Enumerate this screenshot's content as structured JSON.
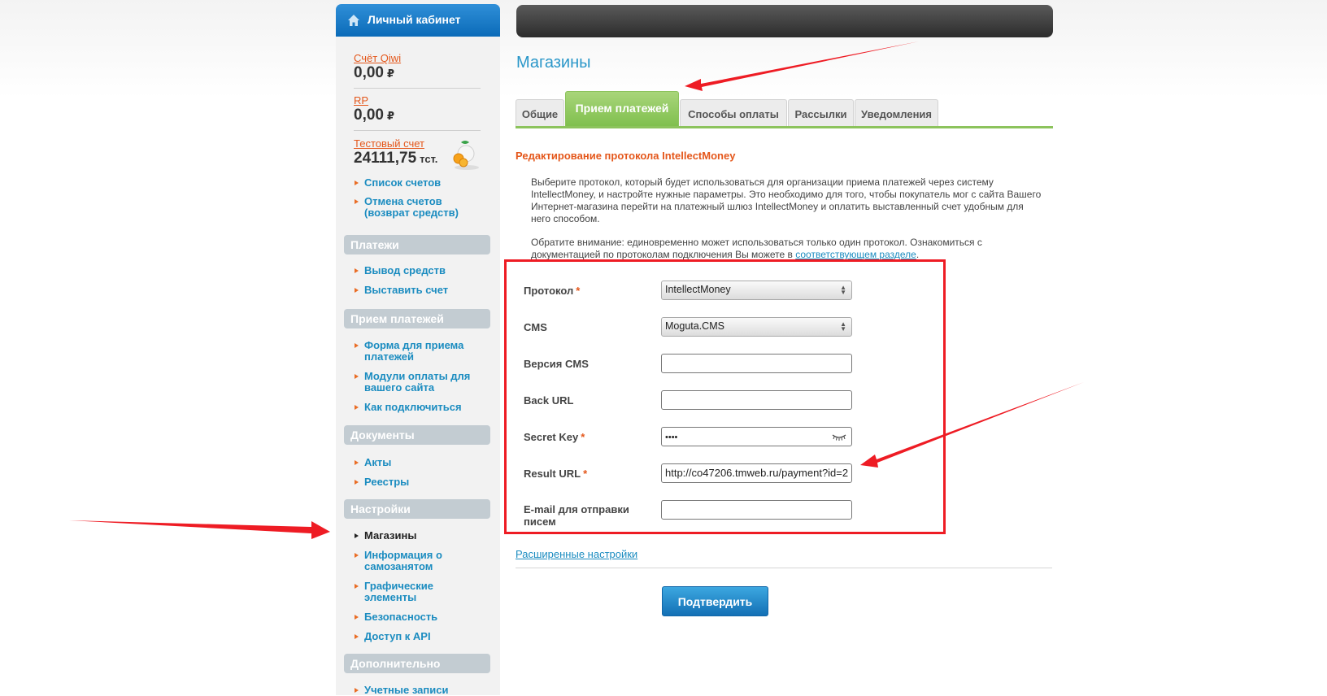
{
  "sidebar": {
    "header": "Личный кабинет",
    "accounts": [
      {
        "label": "Счёт Qiwi",
        "amount": "0,00",
        "currency": "₽"
      },
      {
        "label": "RP",
        "amount": "0,00",
        "currency": "₽"
      },
      {
        "label": "Тестовый счет",
        "amount": "24111,75",
        "currency": "тст."
      }
    ],
    "accounts_menu": [
      "Список счетов",
      "Отмена счетов (возврат средств)"
    ],
    "sections": [
      {
        "title": "Платежи",
        "items": [
          "Вывод средств",
          "Выставить счет"
        ]
      },
      {
        "title": "Прием платежей",
        "items": [
          "Форма для приема платежей",
          "Модули оплаты для вашего сайта",
          "Как подключиться"
        ]
      },
      {
        "title": "Документы",
        "items": [
          "Акты",
          "Реестры"
        ]
      },
      {
        "title": "Настройки",
        "items": [
          "Магазины",
          "Информация о самозанятом",
          "Графические элементы",
          "Безопасность",
          "Доступ к API"
        ]
      },
      {
        "title": "Дополнительно",
        "items": [
          "Учетные записи"
        ]
      }
    ]
  },
  "main": {
    "title": "Магазины",
    "tabs": [
      "Общие",
      "Прием платежей",
      "Способы оплаты",
      "Рассылки",
      "Уведомления"
    ],
    "active_tab": "Прием платежей",
    "subtitle": "Редактирование протокола IntellectMoney",
    "intro_1": "Выберите протокол, который будет использоваться для организации приема платежей через систему IntellectMoney, и настройте нужные параметры. Это необходимо для того, чтобы покупатель мог с сайта Вашего Интернет-магазина перейти на платежный шлюз IntellectMoney и оплатить выставленный счет удобным для него способом.",
    "intro_2_text": "Обратите внимание: единовременно может использоваться только один протокол. Ознакомиться с документацией по протоколам подключения Вы можете в ",
    "intro_2_link": "соответствующем разделе",
    "intro_2_end": ".",
    "form": {
      "protocol": {
        "label": "Протокол",
        "value": "IntellectMoney"
      },
      "cms": {
        "label": "CMS",
        "value": "Moguta.CMS"
      },
      "cms_version": {
        "label": "Версия CMS",
        "value": ""
      },
      "back_url": {
        "label": "Back URL",
        "value": ""
      },
      "secret_key": {
        "label": "Secret Key",
        "value": "••••"
      },
      "result_url": {
        "label": "Result URL",
        "value": "http://co47206.tmweb.ru/payment?id=2"
      },
      "email": {
        "label": "E-mail для отправки писем",
        "value": ""
      }
    },
    "required_mark": "*",
    "advanced_link": "Расширенные настройки",
    "confirm_button": "Подтвердить"
  },
  "colors": {
    "accent_blue": "#1b8cc0",
    "orange": "#e4571b",
    "tab_green": "#8cc35c",
    "annotation_red": "#ee1c24"
  }
}
